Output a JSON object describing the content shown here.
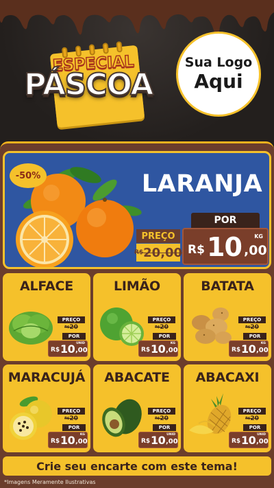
{
  "header": {
    "title_top": "ESPECIAL",
    "title_main": "PÁSCOA",
    "logo_line1": "Sua Logo",
    "logo_line2": "Aqui"
  },
  "hero": {
    "discount": "-50%",
    "name": "LARANJA",
    "preco_label": "PREÇO",
    "old_currency": "R$",
    "old_price": "20,00",
    "por_label": "POR",
    "currency": "R$",
    "price_int": "10",
    "price_cents": ",00",
    "unit": "KG"
  },
  "products": [
    {
      "name": "ALFACE",
      "preco_label": "PREÇO",
      "old_currency": "R$",
      "old_price": "20",
      "por_label": "POR",
      "currency": "R$",
      "price_int": "10",
      "price_cents": ",00",
      "unit": "UNID"
    },
    {
      "name": "LIMÃO",
      "preco_label": "PREÇO",
      "old_currency": "R$",
      "old_price": "20",
      "por_label": "POR",
      "currency": "R$",
      "price_int": "10",
      "price_cents": ",00",
      "unit": "KG"
    },
    {
      "name": "BATATA",
      "preco_label": "PREÇO",
      "old_currency": "R$",
      "old_price": "20",
      "por_label": "POR",
      "currency": "R$",
      "price_int": "10",
      "price_cents": ",00",
      "unit": "KG"
    },
    {
      "name": "MARACUJÁ",
      "preco_label": "PREÇO",
      "old_currency": "R$",
      "old_price": "20",
      "por_label": "POR",
      "currency": "R$",
      "price_int": "10",
      "price_cents": ",00",
      "unit": "KG"
    },
    {
      "name": "ABACATE",
      "preco_label": "PREÇO",
      "old_currency": "R$",
      "old_price": "20",
      "por_label": "POR",
      "currency": "R$",
      "price_int": "10",
      "price_cents": ",00",
      "unit": "UNID"
    },
    {
      "name": "ABACAXI",
      "preco_label": "PREÇO",
      "old_currency": "R$",
      "old_price": "20",
      "por_label": "POR",
      "currency": "R$",
      "price_int": "10",
      "price_cents": ",00",
      "unit": "UNID"
    }
  ],
  "footer": {
    "cta": "Crie seu encarte com este tema!",
    "disclaimer": "*Imagens Meramente Ilustrativas"
  },
  "colors": {
    "background_dark": "#2a2522",
    "chocolate": "#6b3d2c",
    "gold": "#f5c12b",
    "hero_blue": "#2f56a1",
    "price_box": "#7a3e2a"
  }
}
